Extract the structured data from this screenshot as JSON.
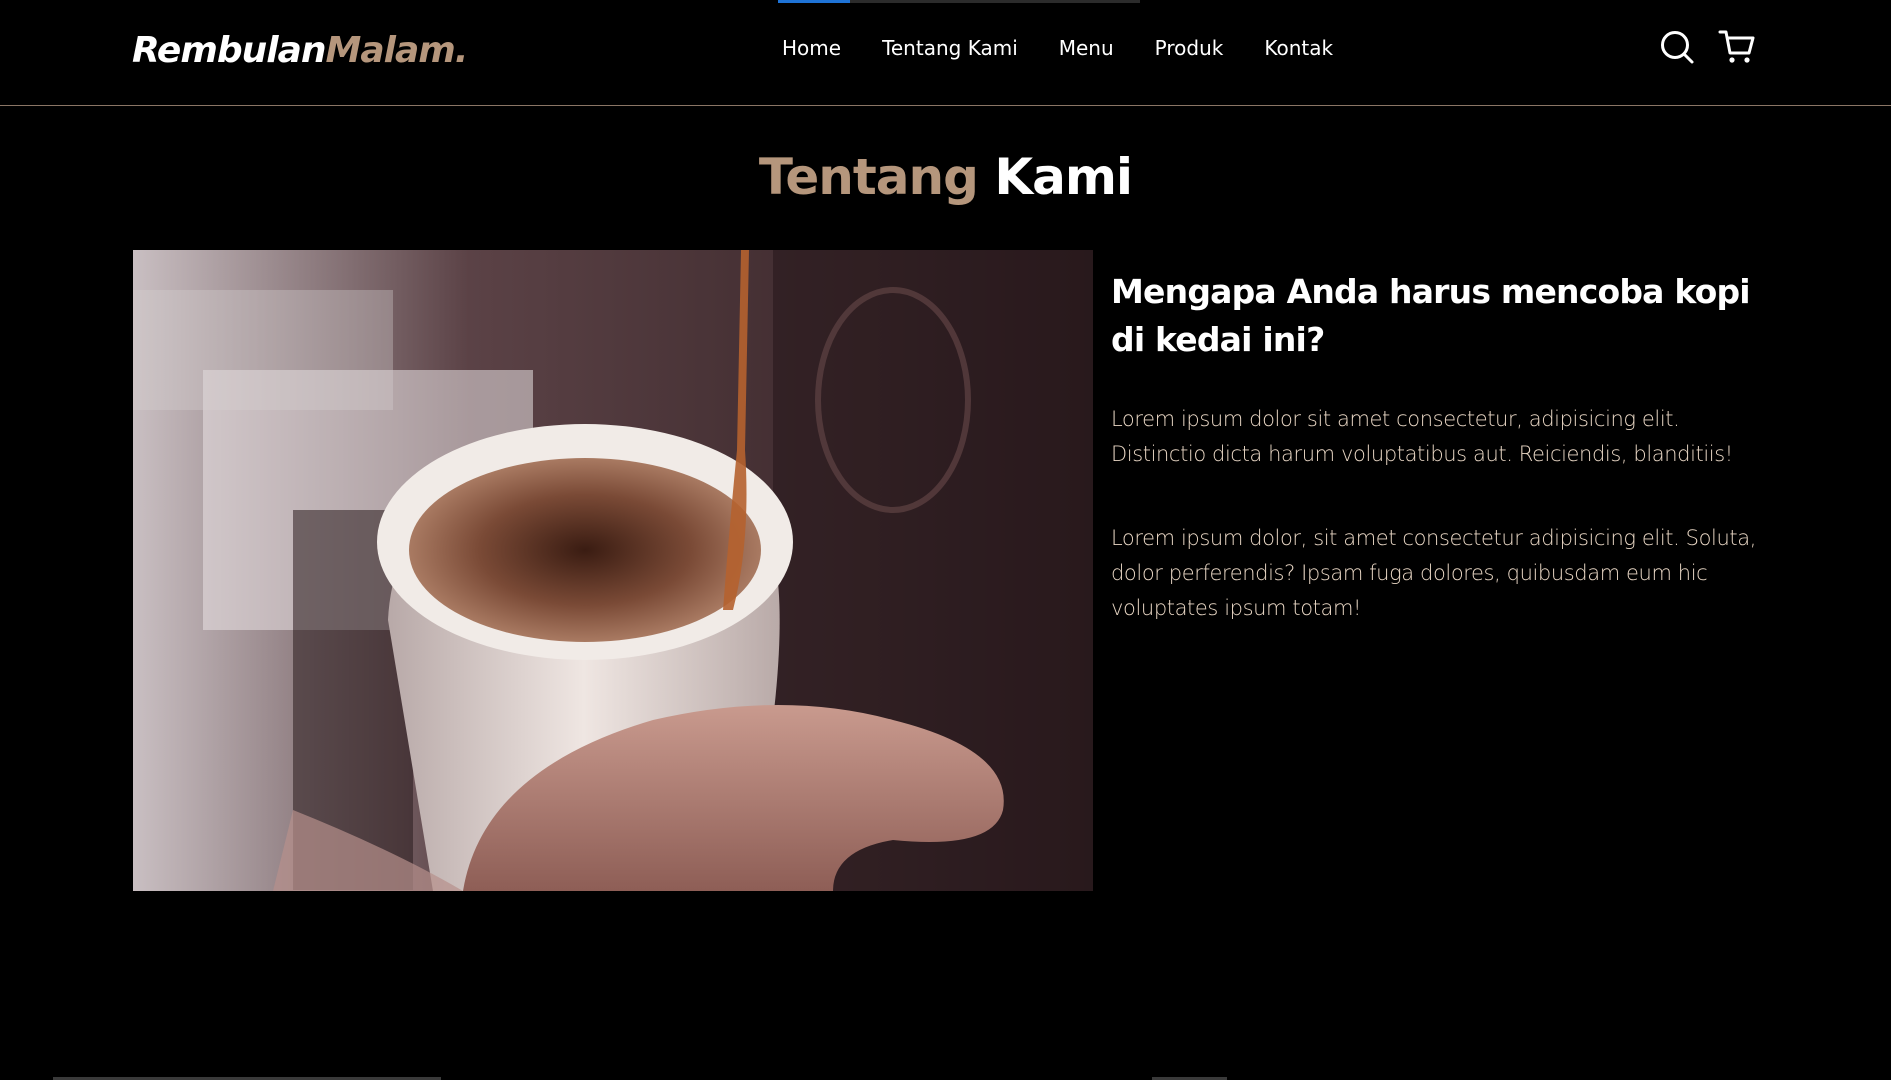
{
  "brand": {
    "name_part1": "Rembulan",
    "name_part2": "Malam.",
    "accent_color": "#b5967c"
  },
  "nav": {
    "items": [
      {
        "label": "Home"
      },
      {
        "label": "Tentang Kami"
      },
      {
        "label": "Menu"
      },
      {
        "label": "Produk"
      },
      {
        "label": "Kontak"
      }
    ],
    "icons": [
      "search-icon",
      "shopping-cart-icon"
    ]
  },
  "about": {
    "title_part1": "Tentang",
    "title_part2": "Kami",
    "heading": "Mengapa Anda harus mencoba kopi di kedai ini?",
    "paragraph1": "Lorem ipsum dolor sit amet consectetur, adipisicing elit. Distinctio dicta harum voluptatibus aut. Reiciendis, blanditiis!",
    "paragraph2": "Lorem ipsum dolor, sit amet consectetur adipisicing elit. Soluta, dolor perferendis? Ipsam fuga dolores, quibusdam eum hic voluptates ipsum totam!",
    "image_subject": "coffee-pour-cup-image"
  }
}
